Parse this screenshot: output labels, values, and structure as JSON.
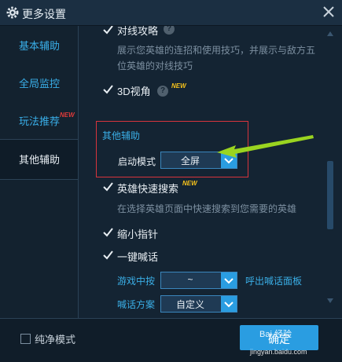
{
  "window": {
    "title": "更多设置"
  },
  "sidebar": {
    "items": [
      {
        "label": "基本辅助"
      },
      {
        "label": "全局监控"
      },
      {
        "label": "玩法推荐",
        "badge": "NEW"
      },
      {
        "label": "其他辅助"
      }
    ]
  },
  "content": {
    "duixian": {
      "label": "对线攻略",
      "desc_line1": "展示您英雄的连招和使用技巧，并展示与敌方五",
      "desc_line2": "位英雄的对线技巧"
    },
    "view3d": {
      "label": "3D视角",
      "badge": "NEW"
    },
    "other_section": {
      "title": "其他辅助",
      "start_mode_label": "启动模式",
      "start_mode_value": "全屏"
    },
    "hero_search": {
      "label": "英雄快速搜索",
      "badge": "NEW",
      "desc": "在选择英雄页面中快速搜索到您需要的英雄"
    },
    "shrink_cursor": {
      "label": "缩小指针"
    },
    "shout": {
      "label": "一键喊话",
      "hotkey_label": "游戏中按",
      "hotkey_value": "~",
      "hotkey_suffix": "呼出喊话面板",
      "scheme_label": "喊话方案",
      "scheme_value": "自定义"
    }
  },
  "footer": {
    "pure_mode_label": "纯净模式",
    "ok_label": "确定"
  },
  "watermark": {
    "brand": "Bai 经验",
    "url": "jingyan.baidu.com"
  },
  "colors": {
    "accent": "#2a9de1",
    "highlight_box": "#d8343c",
    "annotation_arrow": "#9ad420",
    "new_badge": "#f6c21b"
  }
}
